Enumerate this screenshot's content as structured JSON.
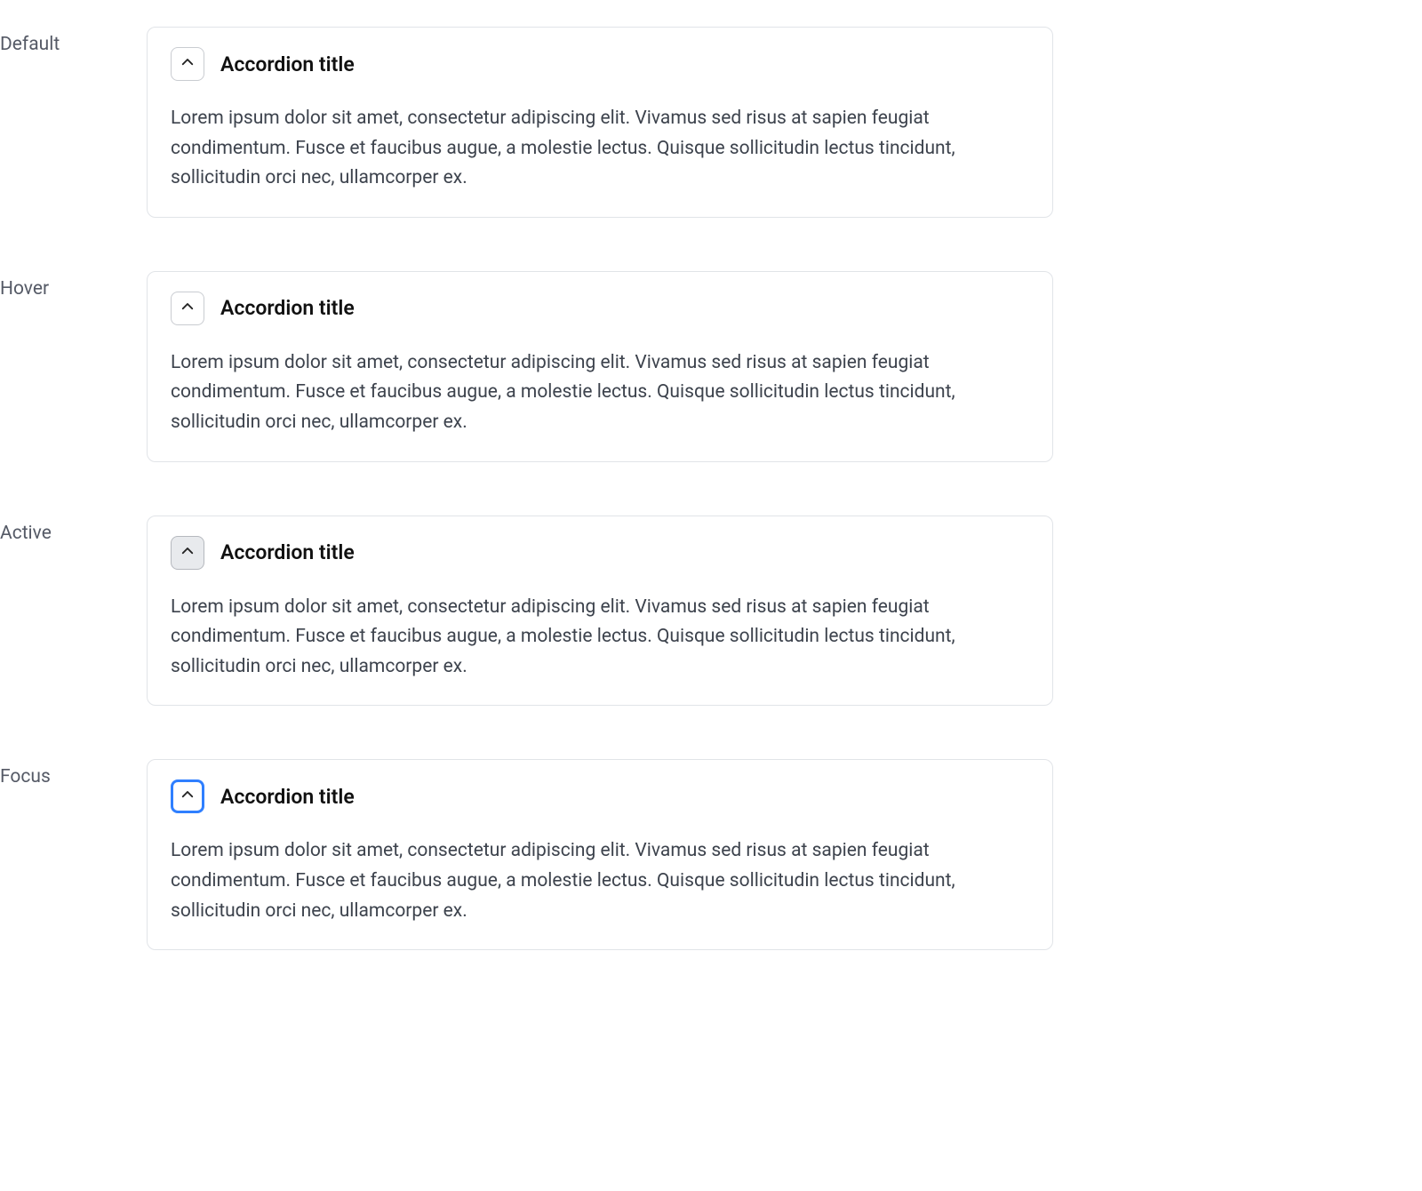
{
  "states": [
    {
      "label": "Default",
      "title": "Accordion title",
      "body": "Lorem ipsum dolor sit amet, consectetur adipiscing elit. Vivamus sed risus at sapien feugiat condimentum. Fusce et faucibus augue, a molestie lectus. Quisque sollicitudin lectus tincidunt, sollicitudin orci nec, ullamcorper ex.",
      "variant": "default"
    },
    {
      "label": "Hover",
      "title": "Accordion title",
      "body": "Lorem ipsum dolor sit amet, consectetur adipiscing elit. Vivamus sed risus at sapien feugiat condimentum. Fusce et faucibus augue, a molestie lectus. Quisque sollicitudin lectus tincidunt, sollicitudin orci nec, ullamcorper ex.",
      "variant": "hover"
    },
    {
      "label": "Active",
      "title": "Accordion title",
      "body": "Lorem ipsum dolor sit amet, consectetur adipiscing elit. Vivamus sed risus at sapien feugiat condimentum. Fusce et faucibus augue, a molestie lectus. Quisque sollicitudin lectus tincidunt, sollicitudin orci nec, ullamcorper ex.",
      "variant": "active"
    },
    {
      "label": "Focus",
      "title": "Accordion title",
      "body": "Lorem ipsum dolor sit amet, consectetur adipiscing elit. Vivamus sed risus at sapien feugiat condimentum. Fusce et faucibus augue, a molestie lectus. Quisque sollicitudin lectus tincidunt, sollicitudin orci nec, ullamcorper ex.",
      "variant": "focus"
    }
  ]
}
